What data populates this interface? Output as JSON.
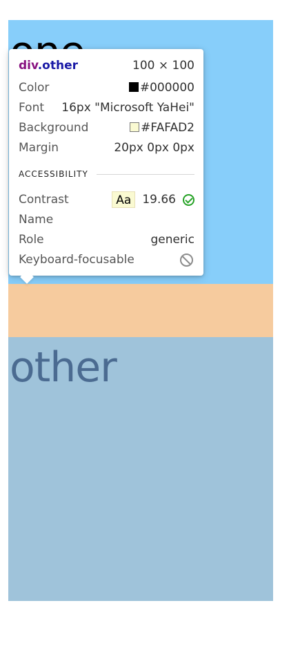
{
  "page": {
    "text_one": "one",
    "text_other": "other"
  },
  "tooltip": {
    "tag": "div",
    "class": ".other",
    "size": "100 × 100",
    "color": {
      "label": "Color",
      "value": "#000000"
    },
    "font": {
      "label": "Font",
      "value": "16px \"Microsoft YaHei\""
    },
    "background": {
      "label": "Background",
      "value": "#FAFAD2"
    },
    "margin": {
      "label": "Margin",
      "value": "20px 0px 0px"
    },
    "accessibility": {
      "title": "ACCESSIBILITY",
      "contrast": {
        "label": "Contrast",
        "badge": "Aa",
        "value": "19.66"
      },
      "name": {
        "label": "Name",
        "value": ""
      },
      "role": {
        "label": "Role",
        "value": "generic"
      },
      "keyboard": {
        "label": "Keyboard-focusable"
      }
    }
  },
  "colors": {
    "box_one_background": "#87CEFA",
    "margin_overlay": "#F6CB9E",
    "box_other_background": "#9FC3DA",
    "selector_tag": "#881280",
    "selector_class": "#1A1AA6",
    "pass_icon": "#26A226"
  },
  "icons": {
    "contrast_status": "check-circle-icon",
    "keyboard_status": "not-focusable-icon"
  }
}
